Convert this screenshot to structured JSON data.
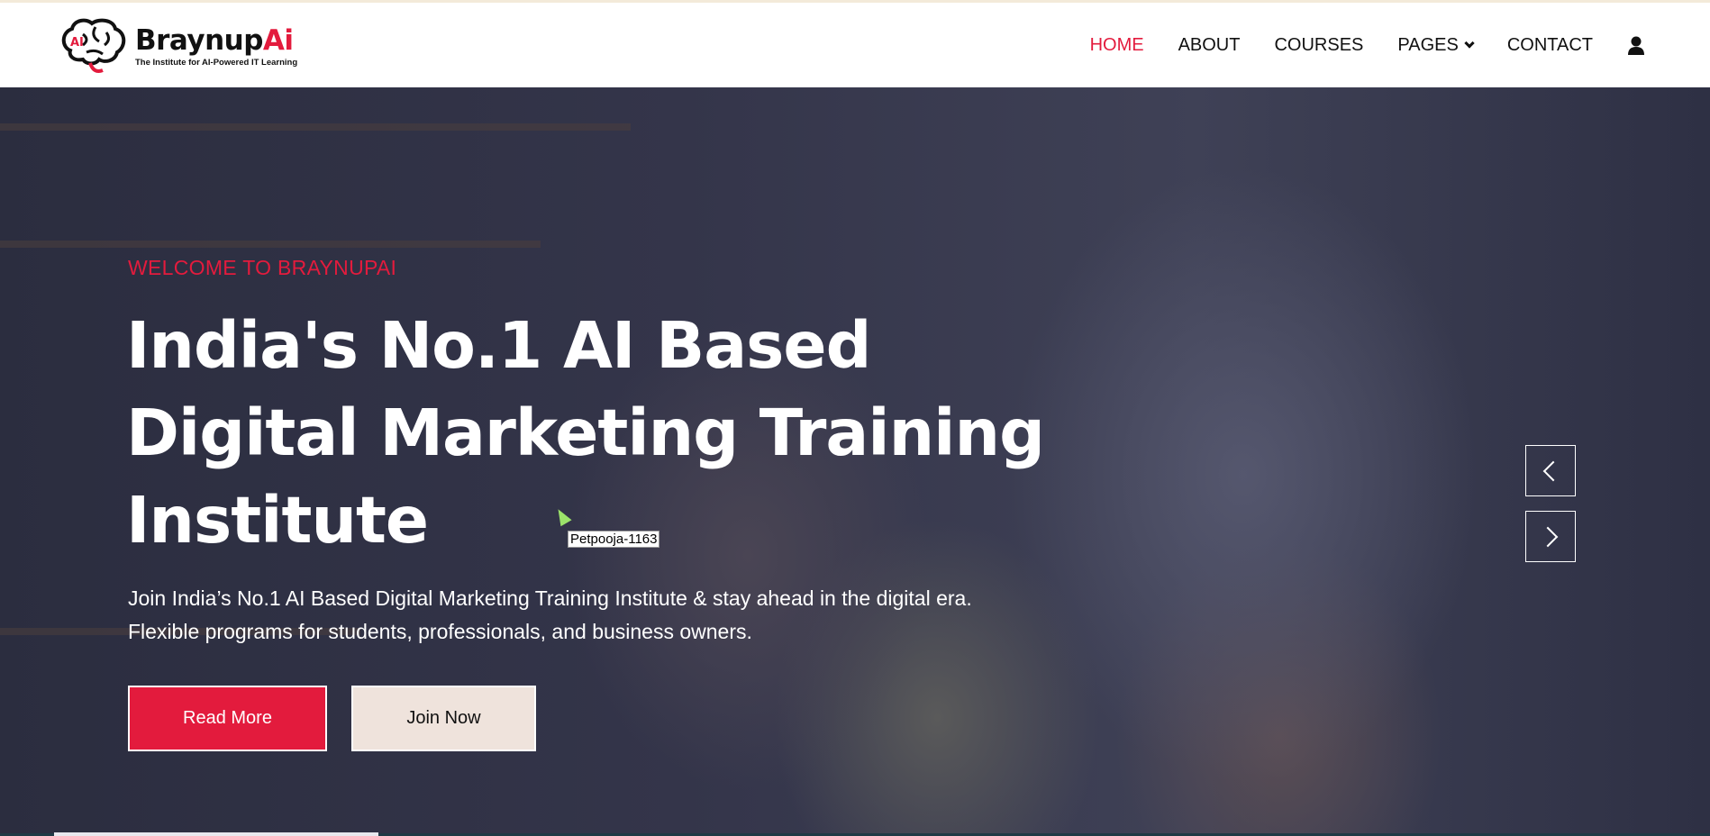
{
  "header": {
    "logo": {
      "name": "Braynup",
      "name_accent": "Ai",
      "badge": "AI",
      "tagline": "The Institute for AI-Powered IT Learning"
    },
    "nav": [
      {
        "label": "HOME",
        "active": true
      },
      {
        "label": "ABOUT"
      },
      {
        "label": "COURSES"
      },
      {
        "label": "PAGES",
        "dropdown": true
      },
      {
        "label": "CONTACT"
      }
    ],
    "user_icon": "user-icon"
  },
  "hero": {
    "eyebrow": "WELCOME TO BRAYNUPAI",
    "title_lines": [
      "India's No.1 AI Based",
      "Digital Marketing Training",
      "Institute"
    ],
    "description_lines": [
      "Join India’s No.1 AI Based Digital Marketing Training Institute & stay ahead in the digital era.",
      "Flexible programs for students, professionals, and business owners."
    ],
    "buttons": {
      "read_more": "Read More",
      "join_now": "Join Now"
    },
    "tooltip": "Petpooja-1163"
  },
  "colors": {
    "accent": "#e31b3d",
    "join_bg": "#efe3dc"
  }
}
